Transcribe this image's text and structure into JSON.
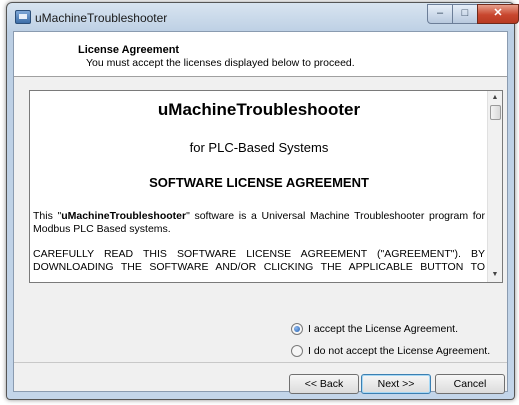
{
  "window": {
    "title": "uMachineTroubleshooter"
  },
  "header": {
    "title": "License Agreement",
    "subtitle": "You must accept the licenses displayed below to proceed."
  },
  "license": {
    "title": "uMachineTroubleshooter",
    "subtitle": "for PLC-Based Systems",
    "heading": "SOFTWARE LICENSE AGREEMENT",
    "p1_prefix": "This \"",
    "p1_bold": "uMachineTroubleshooter",
    "p1_suffix": "\" software is a Universal Machine Troubleshooter program for Modbus PLC Based systems.",
    "p2": "CAREFULLY READ THIS SOFTWARE LICENSE AGREEMENT (\"AGREEMENT\"). BY DOWNLOADING THE SOFTWARE AND/OR CLICKING THE APPLICABLE BUTTON TO"
  },
  "options": {
    "accept": "I accept the License Agreement.",
    "decline": "I do not accept the License Agreement.",
    "selected": "accept"
  },
  "buttons": {
    "back": "<< Back",
    "next": "Next >>",
    "cancel": "Cancel"
  },
  "icons": {
    "minimize": "minimize-icon",
    "maximize": "maximize-icon",
    "close": "close-icon",
    "scroll_up": "scroll-up-icon",
    "scroll_down": "scroll-down-icon"
  }
}
